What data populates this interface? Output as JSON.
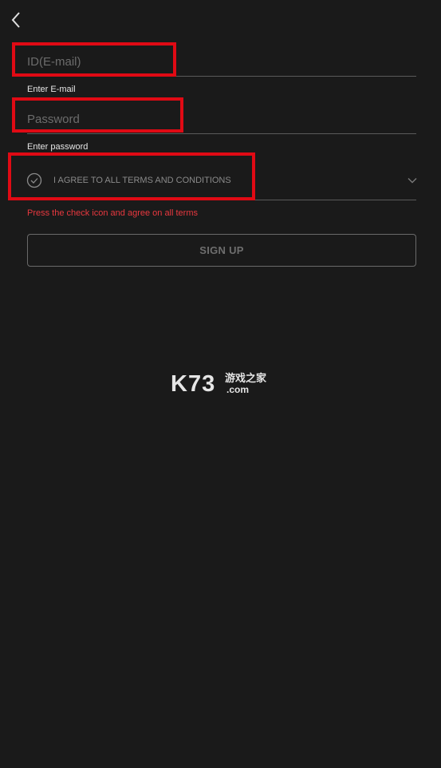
{
  "header": {
    "back_icon": "chevron-left-icon"
  },
  "form": {
    "email": {
      "placeholder": "ID(E-mail)",
      "value": "",
      "helper": "Enter E-mail"
    },
    "password": {
      "placeholder": "Password",
      "value": "",
      "helper": "Enter password"
    },
    "terms": {
      "label": "I AGREE TO ALL TERMS AND CONDITIONS",
      "check_icon": "check-circle-icon",
      "expand_icon": "chevron-down-icon",
      "checked": false
    },
    "error": "Press the check icon and agree on all terms",
    "submit_label": "SIGN UP"
  },
  "watermark": {
    "brand": "K73",
    "chinese": "游戏之家",
    "domain": ".com"
  },
  "colors": {
    "background": "#1a1a1a",
    "highlight": "#e00a14",
    "error": "#e8383f",
    "text": "#e6e6e6",
    "muted": "#6c6c6c"
  }
}
